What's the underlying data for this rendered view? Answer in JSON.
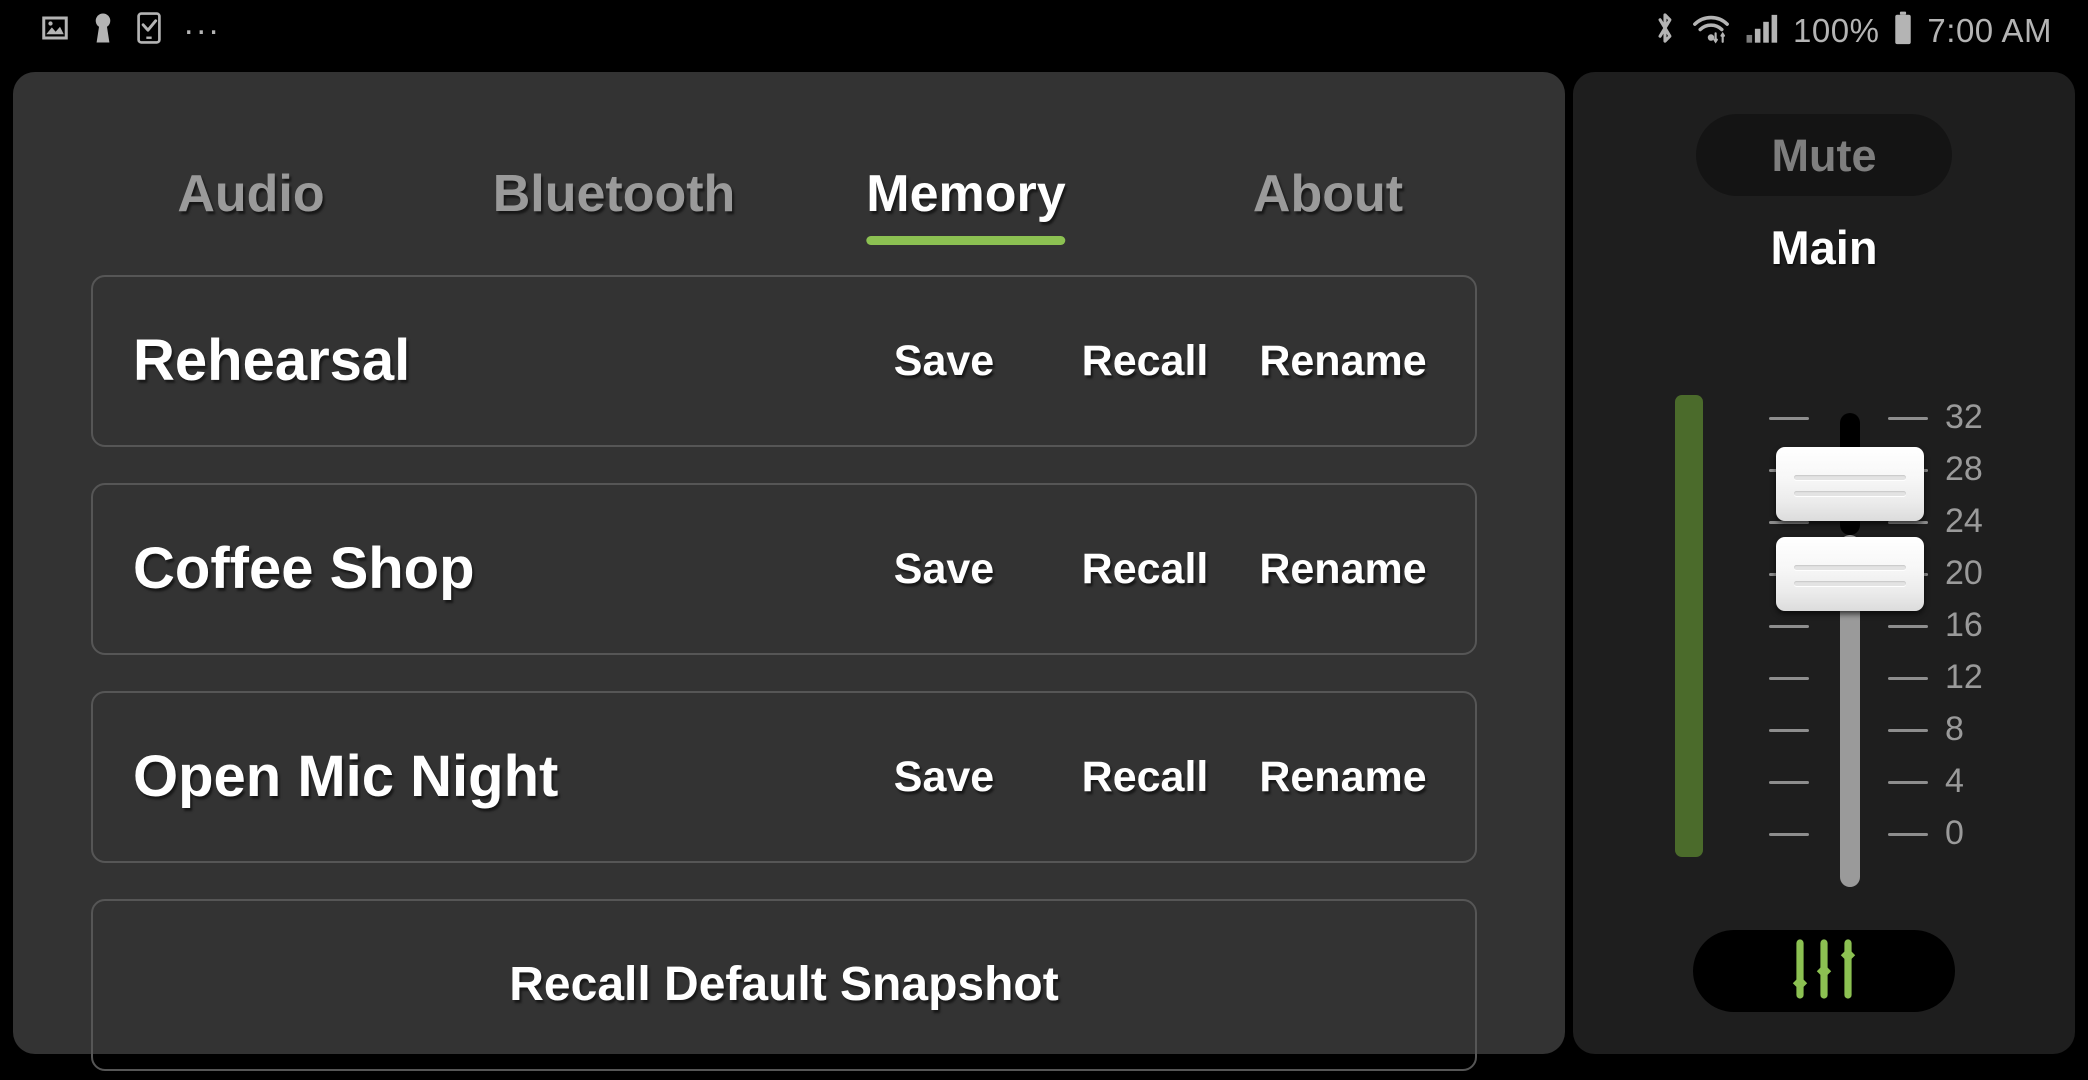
{
  "statusbar": {
    "left_icons": [
      "image-icon",
      "key-icon",
      "tablet-check-icon"
    ],
    "overflow": "...",
    "right_icons": [
      "bluetooth-icon",
      "wifi-icon",
      "cellular-signal-icon",
      "battery-icon"
    ],
    "battery_percent": "100%",
    "time": "7:00 AM"
  },
  "tabs": [
    {
      "label": "Audio",
      "active": false
    },
    {
      "label": "Bluetooth",
      "active": false
    },
    {
      "label": "Memory",
      "active": true
    },
    {
      "label": "About",
      "active": false
    }
  ],
  "memory": {
    "actions": {
      "save": "Save",
      "recall": "Recall",
      "rename": "Rename"
    },
    "snapshots": [
      {
        "name": "Rehearsal"
      },
      {
        "name": "Coffee Shop"
      },
      {
        "name": "Open Mic Night"
      }
    ],
    "default_button": "Recall Default Snapshot"
  },
  "channel_strip": {
    "mute_label": "Mute",
    "channel_label": "Main",
    "eq_button_icon": "sliders-icon",
    "fader": {
      "scale_labels": [
        "32",
        "28",
        "24",
        "20",
        "16",
        "12",
        "8",
        "4",
        "0"
      ],
      "scale_max": 32,
      "scale_min": 0,
      "knob_value": 25,
      "meter_level": 100
    }
  },
  "colors": {
    "accent_green": "#8CC152",
    "meter_green": "#4B6B2B",
    "icon_green": "#8CC152",
    "panel_bg": "#333333",
    "side_panel_bg": "#1E1E1E",
    "screen_bg": "#000000"
  }
}
